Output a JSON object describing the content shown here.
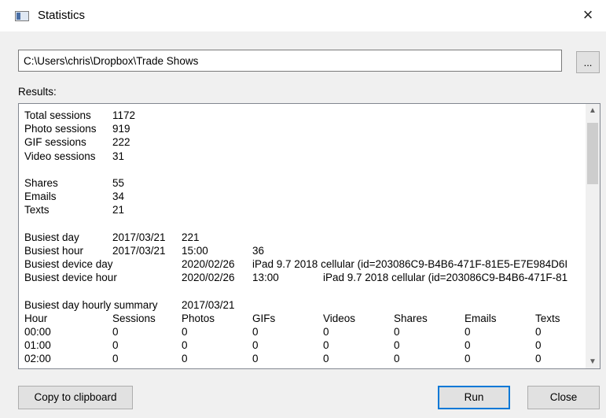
{
  "window": {
    "title": "Statistics",
    "close_glyph": "×"
  },
  "path": {
    "value": "C:\\Users\\chris\\Dropbox\\Trade Shows",
    "browse_label": "..."
  },
  "results_label": "Results:",
  "summary": {
    "total_sessions": [
      "Total sessions",
      "1172"
    ],
    "photo_sessions": [
      "Photo sessions",
      "919"
    ],
    "gif_sessions": [
      "GIF sessions",
      "222"
    ],
    "video_sessions": [
      "Video sessions",
      "31"
    ],
    "shares": [
      "Shares",
      "55"
    ],
    "emails": [
      "Emails",
      "34"
    ],
    "texts": [
      "Texts",
      "21"
    ]
  },
  "busiest": {
    "day": [
      "Busiest day",
      "2017/03/21",
      "221"
    ],
    "hour": [
      "Busiest hour",
      "2017/03/21",
      "15:00",
      "36"
    ],
    "device_day": [
      "Busiest device day",
      "2020/02/26",
      "iPad 9.7 2018 cellular (id=203086C9-B4B6-471F-81E5-E7E984D6I"
    ],
    "device_hour": [
      "Busiest device hour",
      "2020/02/26",
      "13:00",
      "iPad 9.7 2018 cellular (id=203086C9-B4B6-471F-81"
    ]
  },
  "hourly_summary": {
    "label": "Busiest day hourly summary",
    "date": "2017/03/21",
    "headers": [
      "Hour",
      "Sessions",
      "Photos",
      "GIFs",
      "Videos",
      "Shares",
      "Emails",
      "Texts"
    ],
    "rows": [
      [
        "00:00",
        "0",
        "0",
        "0",
        "0",
        "0",
        "0",
        "0"
      ],
      [
        "01:00",
        "0",
        "0",
        "0",
        "0",
        "0",
        "0",
        "0"
      ],
      [
        "02:00",
        "0",
        "0",
        "0",
        "0",
        "0",
        "0",
        "0"
      ]
    ]
  },
  "scrollbar": {
    "up_glyph": "▲",
    "down_glyph": "▼"
  },
  "buttons": {
    "copy": "Copy to clipboard",
    "run": "Run",
    "close": "Close"
  }
}
